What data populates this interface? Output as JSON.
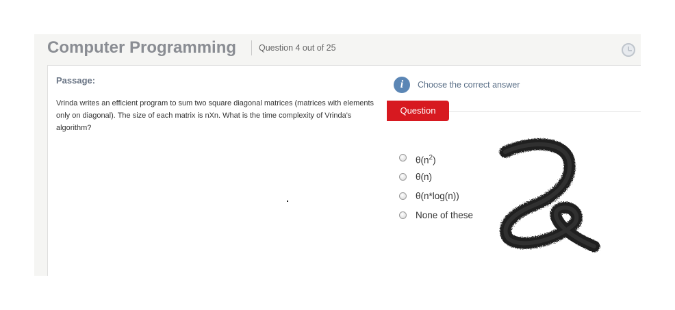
{
  "header": {
    "title": "Computer Programming",
    "question_counter": "Question 4 out of 25",
    "timer_icon": "clock-icon"
  },
  "passage": {
    "heading": "Passage:",
    "text": "Vrinda writes an efficient program to sum two square diagonal matrices (matrices with elements only on diagonal). The size of each matrix is nXn. What is the time complexity of Vrinda's algorithm?"
  },
  "question": {
    "info_icon": "info-icon",
    "instruction": "Choose the correct answer",
    "tab_label": "Question",
    "options": [
      {
        "prefix": "θ(n",
        "sup": "2",
        "suffix": ")"
      },
      {
        "label": "θ(n)"
      },
      {
        "label": "θ(n*log(n))"
      },
      {
        "label": "None of these"
      }
    ]
  },
  "annotation": {
    "description_icon": "handwritten-scribble",
    "color": "#111111"
  },
  "colors": {
    "accent_red": "#d71920",
    "title_gray": "#8a8d93",
    "info_blue": "#5b86b5",
    "background": "#f5f5f3"
  }
}
